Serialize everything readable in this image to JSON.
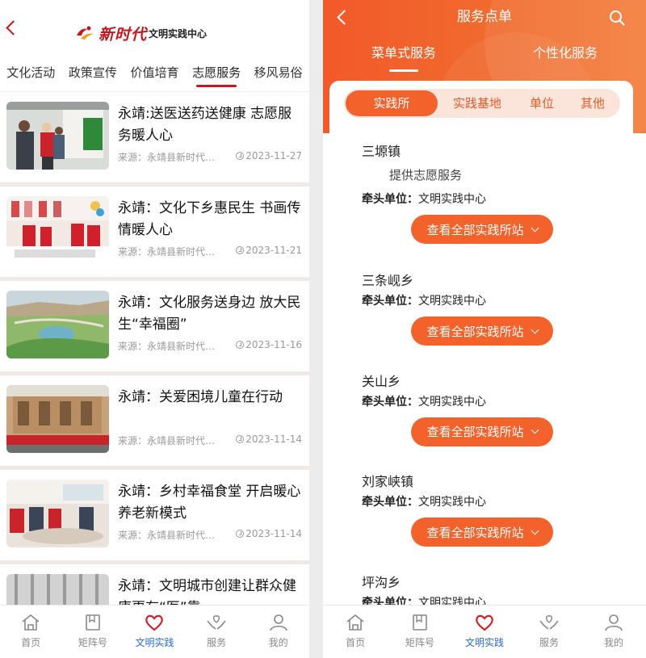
{
  "left": {
    "logo": {
      "main": "新时代",
      "sub": "文明实践中心"
    },
    "categories": [
      {
        "label": "文化活动",
        "active": false
      },
      {
        "label": "政策宣传",
        "active": false
      },
      {
        "label": "价值培育",
        "active": false
      },
      {
        "label": "志愿服务",
        "active": true
      },
      {
        "label": "移风易俗",
        "active": false
      }
    ],
    "news": [
      {
        "title": "永靖:送医送药送健康  志愿服务暖人心",
        "source": "来源：永靖县新时代…",
        "date": "2023-11-27"
      },
      {
        "title": "永靖：文化下乡惠民生  书画传情暖人心",
        "source": "来源：永靖县新时代…",
        "date": "2023-11-21"
      },
      {
        "title": "永靖：文化服务送身边  放大民生“幸福圈”",
        "source": "来源：永靖县新时代…",
        "date": "2023-11-16"
      },
      {
        "title": "永靖：关爱困境儿童在行动",
        "source": "来源：永靖县新时代…",
        "date": "2023-11-14"
      },
      {
        "title": "永靖：乡村幸福食堂  开启暖心养老新模式",
        "source": "来源：永靖县新时代…",
        "date": "2023-11-14"
      },
      {
        "title": "永靖：文明城市创建让群众健康更有“医”靠",
        "source": "",
        "date": ""
      }
    ]
  },
  "right": {
    "title": "服务点单",
    "modes": [
      {
        "label": "菜单式服务",
        "active": true
      },
      {
        "label": "个性化服务",
        "active": false
      }
    ],
    "segments": [
      {
        "label": "实践所",
        "active": true
      },
      {
        "label": "实践基地",
        "active": false
      },
      {
        "label": "单位",
        "active": false
      },
      {
        "label": "其他",
        "active": false
      }
    ],
    "towns": [
      {
        "name": "三塬镇",
        "desc": "提供志愿服务",
        "lead_label": "牵头单位：",
        "lead": "文明实践中心",
        "button": "查看全部实践所站"
      },
      {
        "name": "三条岘乡",
        "desc": "",
        "lead_label": "牵头单位：",
        "lead": "文明实践中心",
        "button": "查看全部实践所站"
      },
      {
        "name": "关山乡",
        "desc": "",
        "lead_label": "牵头单位：",
        "lead": "文明实践中心",
        "button": "查看全部实践所站"
      },
      {
        "name": "刘家峡镇",
        "desc": "",
        "lead_label": "牵头单位：",
        "lead": "文明实践中心",
        "button": "查看全部实践所站"
      },
      {
        "name": "坪沟乡",
        "desc": "",
        "lead_label": "牵头单位：",
        "lead": "文明实践中心",
        "button": ""
      }
    ]
  },
  "tabbar": [
    {
      "label": "首页",
      "icon": "home-icon",
      "active": false
    },
    {
      "label": "矩阵号",
      "icon": "bookmark-icon",
      "active": false
    },
    {
      "label": "文明实践",
      "icon": "heart-icon",
      "active": true
    },
    {
      "label": "服务",
      "icon": "hands-heart-icon",
      "active": false
    },
    {
      "label": "我的",
      "icon": "user-icon",
      "active": false
    }
  ],
  "colors": {
    "brand_red": "#c5171e",
    "orange": "#f4622c",
    "active_tab": "#2b6cd8"
  }
}
